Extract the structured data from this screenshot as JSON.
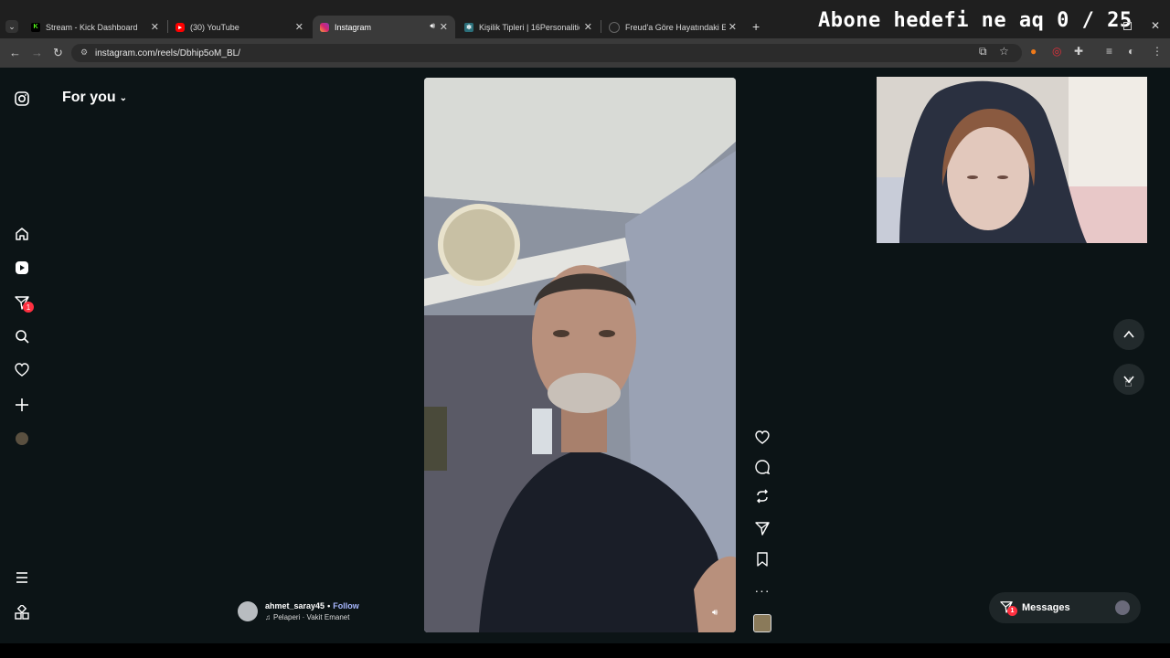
{
  "browser": {
    "tabs": [
      {
        "label": "Stream - Kick Dashboard",
        "favicon": "kick-icon",
        "active": false
      },
      {
        "label": "(30) YouTube",
        "favicon": "youtube-icon",
        "active": false
      },
      {
        "label": "Instagram",
        "favicon": "instagram-icon",
        "active": true
      },
      {
        "label": "Kişilik Tipleri | 16Personalities",
        "favicon": "personalities-icon",
        "active": false
      },
      {
        "label": "Freud'a Göre Hayatındaki Eksik",
        "favicon": "page-icon",
        "active": false
      }
    ],
    "url": "instagram.com/reels/Dbhip5oM_BL/"
  },
  "overlay": {
    "goal_text": "Abone hedefi ne aq 0 / 25"
  },
  "instagram": {
    "feed_title": "For you",
    "notification_count": "1",
    "reel": {
      "username": "ahmet_saray45",
      "separator": "•",
      "follow_label": "Follow",
      "audio": "Pelaperi · Vakit Emanet"
    },
    "messages": {
      "label": "Messages",
      "badge": "1"
    }
  },
  "colors": {
    "accent_follow": "#a8b8ff",
    "badge": "#ff3040",
    "page_bg": "#0c1416"
  }
}
